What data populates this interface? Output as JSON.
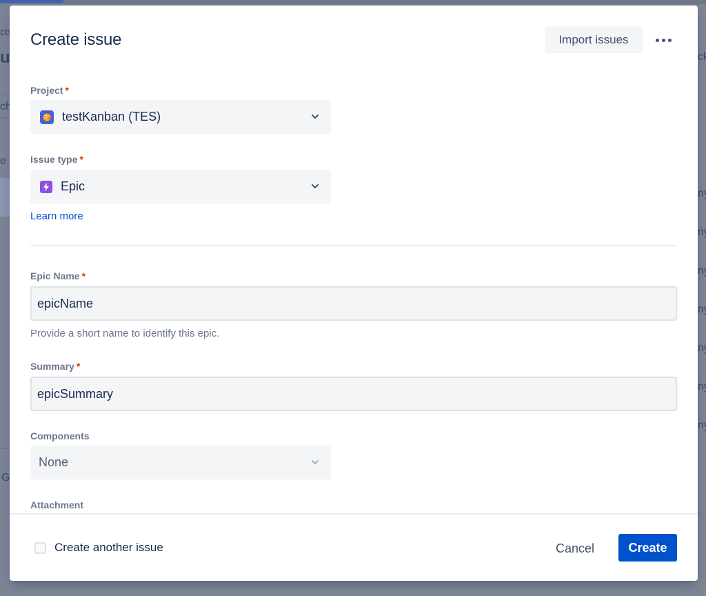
{
  "background": {
    "left_fragments": [
      "cts",
      "ue",
      "ch",
      "e",
      "G"
    ],
    "right_fragments": [
      "ck",
      "ny",
      "ny",
      "ny",
      "ny",
      "ny",
      "ny",
      "ny"
    ]
  },
  "modal": {
    "title": "Create issue",
    "import_label": "Import issues",
    "more_icon": "more-horizontal-icon"
  },
  "fields": {
    "project": {
      "label": "Project",
      "required_mark": "*",
      "value": "testKanban (TES)",
      "icon": "project-avatar-icon"
    },
    "issue_type": {
      "label": "Issue type",
      "required_mark": "*",
      "value": "Epic",
      "icon": "epic-icon",
      "learn_more": "Learn more"
    },
    "epic_name": {
      "label": "Epic Name",
      "required_mark": "*",
      "value": "epicName",
      "helper": "Provide a short name to identify this epic."
    },
    "summary": {
      "label": "Summary",
      "required_mark": "*",
      "value": "epicSummary"
    },
    "components": {
      "label": "Components",
      "value": "None"
    },
    "attachment": {
      "label": "Attachment"
    }
  },
  "footer": {
    "create_another_label": "Create another issue",
    "create_another_checked": false,
    "cancel_label": "Cancel",
    "create_label": "Create"
  },
  "colors": {
    "primary": "#0052cc",
    "required": "#de350b",
    "epic": "#904ee2",
    "project_avatar": "#4c5fd5"
  }
}
